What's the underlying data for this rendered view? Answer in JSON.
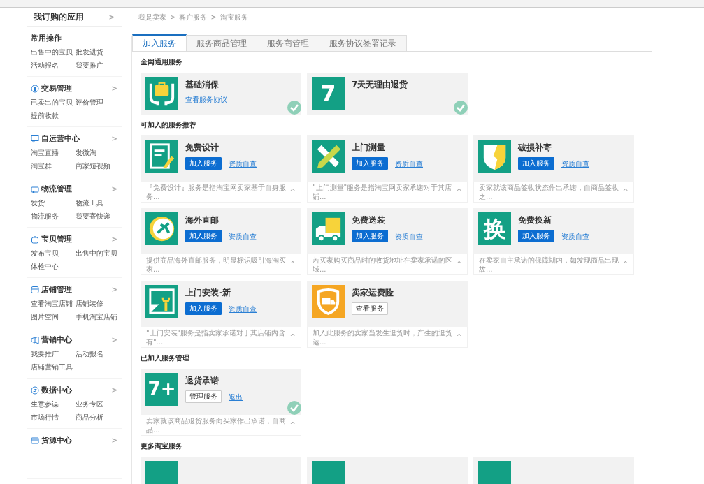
{
  "sidebar": {
    "top_link": {
      "label": "我订购的应用",
      "chevron": ">"
    },
    "groups": [
      {
        "title": "常用操作",
        "links": [
          "出售中的宝贝",
          "批发进货",
          "活动报名",
          "我要推广"
        ]
      },
      {
        "title": "交易管理",
        "chevron": ">",
        "links": [
          "已卖出的宝贝",
          "评价管理",
          "提前收款"
        ]
      },
      {
        "title": "自运营中心",
        "chevron": ">",
        "links": [
          "淘宝直播",
          "发微淘",
          "淘宝群",
          "商家短视频"
        ]
      },
      {
        "title": "物流管理",
        "chevron": ">",
        "links": [
          "发货",
          "物流工具",
          "物流服务",
          "我要寄快递"
        ]
      },
      {
        "title": "宝贝管理",
        "chevron": ">",
        "links": [
          "发布宝贝",
          "出售中的宝贝",
          "体检中心"
        ]
      },
      {
        "title": "店铺管理",
        "chevron": ">",
        "links": [
          "查看淘宝店铺",
          "店铺装修",
          "图片空间",
          "手机淘宝店铺"
        ]
      },
      {
        "title": "营销中心",
        "chevron": ">",
        "links": [
          "我要推广",
          "活动报名",
          "店铺营销工具"
        ]
      },
      {
        "title": "数据中心",
        "chevron": ">",
        "links": [
          "生意参谋",
          "业务专区",
          "市场行情",
          "商品分析"
        ]
      },
      {
        "title": "货源中心",
        "chevron": ">"
      }
    ]
  },
  "breadcrumb": {
    "items": [
      "我是卖家",
      "客户服务",
      "淘宝服务"
    ],
    "separator": ">"
  },
  "tabs": [
    {
      "label": "加入服务",
      "selected": true
    },
    {
      "label": "服务商品管理",
      "selected": false
    },
    {
      "label": "服务商管理",
      "selected": false
    },
    {
      "label": "服务协议签署记录",
      "selected": false
    }
  ],
  "sections": [
    {
      "title": "全网通用服务",
      "cards": [
        {
          "title": "基础消保",
          "color": "#13a085",
          "checked": true,
          "actions": [
            {
              "kind": "link",
              "label": "查看服务协议"
            }
          ]
        },
        {
          "title": "7天无理由退货",
          "color": "#13a085",
          "icon_text": "7",
          "checked": true
        }
      ]
    },
    {
      "title": "可加入的服务推荐",
      "cards": [
        {
          "title": "免费设计",
          "color": "#13a085",
          "checked": false,
          "actions": [
            {
              "kind": "primary",
              "label": "加入服务"
            },
            {
              "kind": "link",
              "label": "资质自查"
            }
          ],
          "description": {
            "text": "『免费设计』服务是指淘宝网卖家基于自身服务...",
            "toggle": "^"
          }
        },
        {
          "title": "上门测量",
          "color": "#13a085",
          "checked": false,
          "actions": [
            {
              "kind": "primary",
              "label": "加入服务"
            },
            {
              "kind": "link",
              "label": "资质自查"
            }
          ],
          "description": {
            "text": "\"上门测量\"服务是指淘宝网卖家承诺对于其店铺...",
            "toggle": "^"
          }
        },
        {
          "title": "破损补寄",
          "color": "#13a085",
          "checked": false,
          "actions": [
            {
              "kind": "primary",
              "label": "加入服务"
            },
            {
              "kind": "link",
              "label": "资质自查"
            }
          ],
          "description": {
            "text": "卖家就该商品签收状态作出承诺，自商品签收之...",
            "toggle": "^"
          }
        },
        {
          "title": "海外直邮",
          "color": "#13a085",
          "checked": false,
          "actions": [
            {
              "kind": "primary",
              "label": "加入服务"
            },
            {
              "kind": "link",
              "label": "资质自查"
            }
          ],
          "description": {
            "text": "提供商品海外直邮服务，明显标识吸引海淘买家...",
            "toggle": "^"
          }
        },
        {
          "title": "免费送装",
          "color": "#13a085",
          "checked": false,
          "actions": [
            {
              "kind": "primary",
              "label": "加入服务"
            },
            {
              "kind": "link",
              "label": "资质自查"
            }
          ],
          "description": {
            "text": "若买家购买商品时的收货地址在卖家承诺的区域...",
            "toggle": "^"
          }
        },
        {
          "title": "免费换新",
          "color": "#13a085",
          "icon_text": "换",
          "checked": false,
          "actions": [
            {
              "kind": "primary",
              "label": "加入服务"
            },
            {
              "kind": "link",
              "label": "资质自查"
            }
          ],
          "description": {
            "text": "在卖家自主承诺的保障期内，如发现商品出现故...",
            "toggle": "^"
          }
        },
        {
          "title": "上门安装-新",
          "color": "#13a085",
          "checked": false,
          "actions": [
            {
              "kind": "primary",
              "label": "加入服务"
            },
            {
              "kind": "link",
              "label": "资质自查"
            }
          ],
          "description": {
            "text": "\"上门安装\"服务是指卖家承诺对于其店铺内含有\"...",
            "toggle": "^"
          }
        },
        {
          "title": "卖家运费险",
          "color": "#f5a623",
          "checked": false,
          "actions": [
            {
              "kind": "outline",
              "label": "查看服务"
            }
          ],
          "description": {
            "text": "加入此服务的卖家当发生退货时，产生的退货运...",
            "toggle": "^"
          }
        }
      ]
    },
    {
      "title": "已加入服务管理",
      "cards": [
        {
          "title": "退货承诺",
          "color": "#13a085",
          "icon_text": "7+",
          "checked": true,
          "actions": [
            {
              "kind": "outline",
              "label": "管理服务"
            },
            {
              "kind": "link",
              "label": "退出"
            }
          ],
          "description": {
            "text": "卖家就该商品退货服务向买家作出承诺，自商品...",
            "toggle": "^"
          }
        }
      ]
    },
    {
      "title": "更多淘宝服务",
      "cards": [
        {
          "color": "#13a085"
        },
        {
          "color": "#13a085"
        },
        {
          "color": "#13a085"
        }
      ]
    }
  ]
}
